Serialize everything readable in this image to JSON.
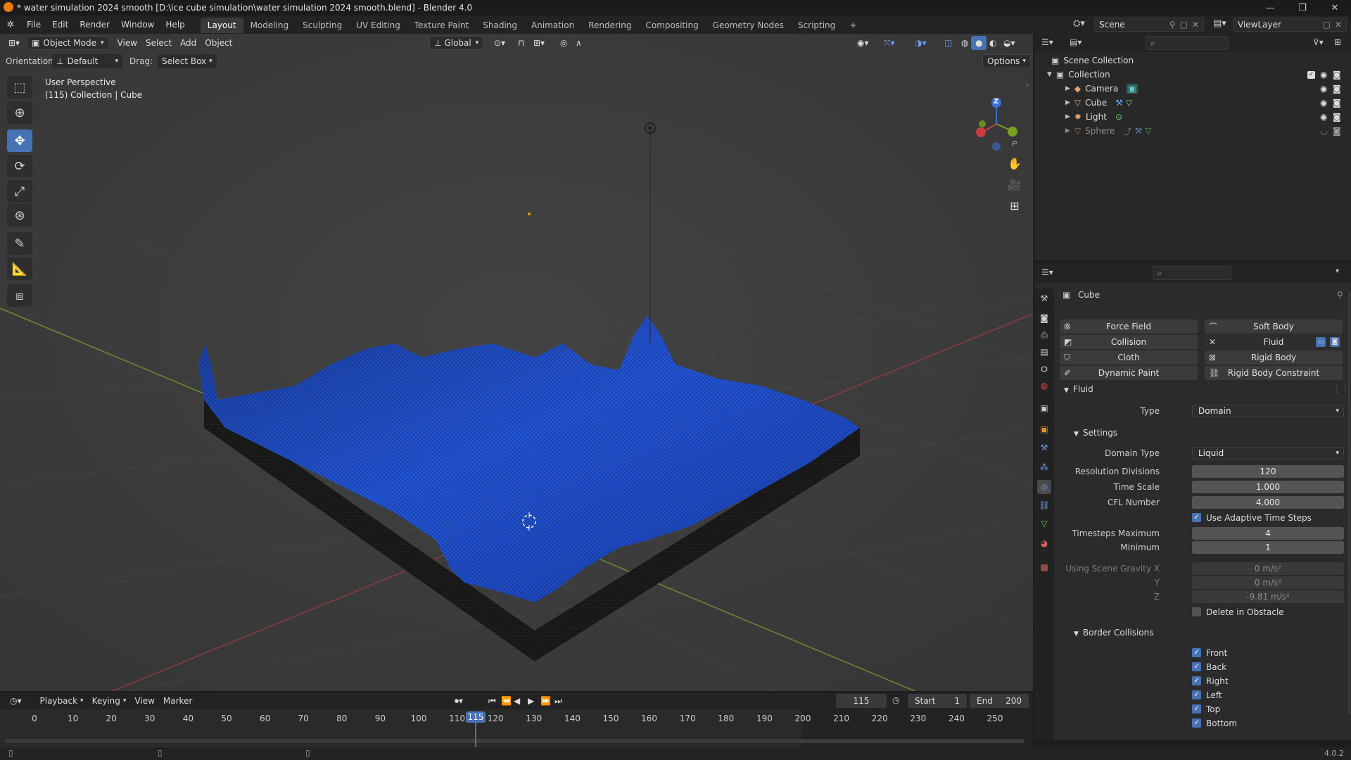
{
  "window": {
    "title": "* water simulation 2024 smooth [D:\\ice cube simulation\\water simulation 2024 smooth.blend] - Blender 4.0",
    "minimize": "—",
    "maximize": "❐",
    "close": "✕"
  },
  "menus": [
    "File",
    "Edit",
    "Render",
    "Window",
    "Help"
  ],
  "workspaces": [
    "Layout",
    "Modeling",
    "Sculpting",
    "UV Editing",
    "Texture Paint",
    "Shading",
    "Animation",
    "Rendering",
    "Compositing",
    "Geometry Nodes",
    "Scripting"
  ],
  "workspace_add": "+",
  "scene": {
    "name": "Scene",
    "view_layer": "ViewLayer"
  },
  "viewport": {
    "mode": "Object Mode",
    "menu": [
      "View",
      "Select",
      "Add",
      "Object"
    ],
    "transform_orientation": "Global",
    "orientation_label": "Orientation:",
    "orientation_value": "Default",
    "drag_label": "Drag:",
    "drag_value": "Select Box",
    "options": "Options",
    "overlay_line1": "User Perspective",
    "overlay_line2": "(115) Collection | Cube",
    "gizmo_z": "Z"
  },
  "outliner": {
    "root": "Scene Collection",
    "collection": "Collection",
    "items": [
      {
        "name": "Camera"
      },
      {
        "name": "Cube"
      },
      {
        "name": "Light"
      },
      {
        "name": "Sphere"
      }
    ]
  },
  "properties": {
    "object_name": "Cube",
    "physics_buttons": {
      "force_field": "Force Field",
      "soft_body": "Soft Body",
      "collision": "Collision",
      "fluid": "Fluid",
      "cloth": "Cloth",
      "rigid_body": "Rigid Body",
      "dynamic_paint": "Dynamic Paint",
      "rigid_body_constraint": "Rigid Body Constraint"
    },
    "fluid_panel": "Fluid",
    "type_label": "Type",
    "type_value": "Domain",
    "settings_panel": "Settings",
    "domain_type_label": "Domain Type",
    "domain_type_value": "Liquid",
    "resolution_label": "Resolution Divisions",
    "resolution_value": "120",
    "time_scale_label": "Time Scale",
    "time_scale_value": "1.000",
    "cfl_label": "CFL Number",
    "cfl_value": "4.000",
    "adaptive_label": "Use Adaptive Time Steps",
    "timesteps_max_label": "Timesteps Maximum",
    "timesteps_max_value": "4",
    "minimum_label": "Minimum",
    "minimum_value": "1",
    "gravity_x_label": "Using Scene Gravity X",
    "gravity_x_value": "0 m/s²",
    "gravity_y_label": "Y",
    "gravity_y_value": "0 m/s²",
    "gravity_z_label": "Z",
    "gravity_z_value": "-9.81 m/s²",
    "delete_obstacle_label": "Delete in Obstacle",
    "border_panel": "Border Collisions",
    "borders": [
      "Front",
      "Back",
      "Right",
      "Left",
      "Top",
      "Bottom"
    ]
  },
  "timeline": {
    "menus": [
      "Playback",
      "Keying",
      "View",
      "Marker"
    ],
    "current_frame": "115",
    "start_label": "Start",
    "start_value": "1",
    "end_label": "End",
    "end_value": "200",
    "ticks": [
      "0",
      "10",
      "20",
      "30",
      "40",
      "50",
      "60",
      "70",
      "80",
      "90",
      "100",
      "110",
      "120",
      "130",
      "140",
      "150",
      "160",
      "170",
      "180",
      "190",
      "200",
      "210",
      "220",
      "230",
      "240",
      "250"
    ],
    "playhead_label": "115"
  },
  "status": {
    "version": "4.0.2"
  },
  "colors": {
    "accent": "#4772b3",
    "water": "#1f4fd6"
  }
}
